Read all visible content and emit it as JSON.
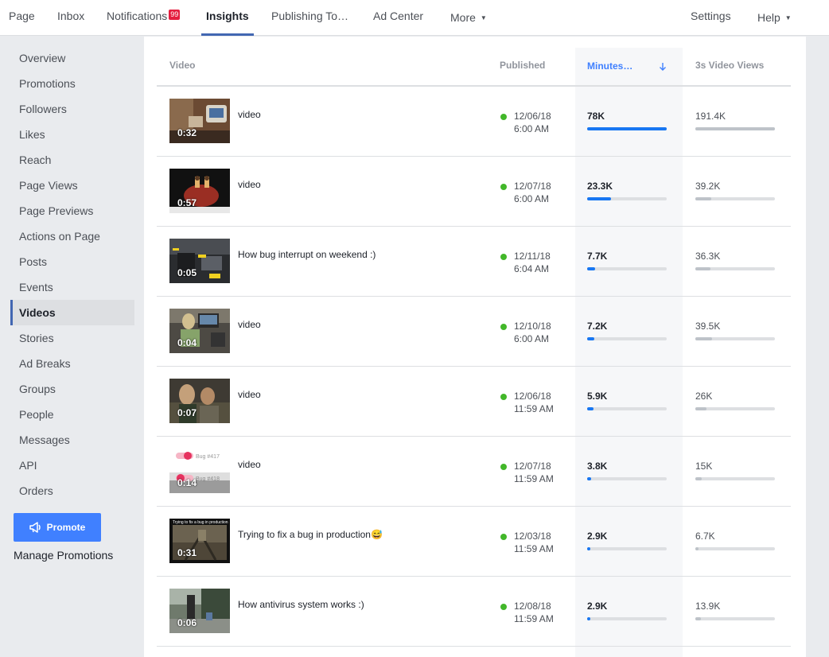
{
  "nav": {
    "tabs": [
      {
        "label": "Page"
      },
      {
        "label": "Inbox"
      },
      {
        "label": "Notifications",
        "badge": "99"
      },
      {
        "label": "Insights"
      },
      {
        "label": "Publishing To…"
      },
      {
        "label": "Ad Center"
      },
      {
        "label": "More"
      }
    ],
    "settings": "Settings",
    "help": "Help",
    "active": "Insights"
  },
  "sidebar": {
    "items": [
      "Overview",
      "Promotions",
      "Followers",
      "Likes",
      "Reach",
      "Page Views",
      "Page Previews",
      "Actions on Page",
      "Posts",
      "Events",
      "Videos",
      "Stories",
      "Ad Breaks",
      "Groups",
      "People",
      "Messages",
      "API",
      "Orders"
    ],
    "active": "Videos",
    "promote_label": "Promote",
    "manage_label": "Manage Promotions"
  },
  "table": {
    "headers": {
      "video": "Video",
      "published": "Published",
      "minutes": "Minutes…",
      "views": "3s Video Views"
    },
    "sort_icon": "arrow-down-icon",
    "rows": [
      {
        "duration": "0:32",
        "title": "video",
        "date": "12/06/18",
        "time": "6:00 AM",
        "minutes": "78K",
        "views": "191.4K",
        "minutes_frac": 1.0,
        "views_frac": 1.0
      },
      {
        "duration": "0:57",
        "title": "video",
        "date": "12/07/18",
        "time": "6:00 AM",
        "minutes": "23.3K",
        "views": "39.2K",
        "minutes_frac": 0.3,
        "views_frac": 0.2
      },
      {
        "duration": "0:05",
        "title": "How bug interrupt on weekend :)",
        "date": "12/11/18",
        "time": "6:04 AM",
        "minutes": "7.7K",
        "views": "36.3K",
        "minutes_frac": 0.1,
        "views_frac": 0.19
      },
      {
        "duration": "0:04",
        "title": "video",
        "date": "12/10/18",
        "time": "6:00 AM",
        "minutes": "7.2K",
        "views": "39.5K",
        "minutes_frac": 0.09,
        "views_frac": 0.21
      },
      {
        "duration": "0:07",
        "title": "video",
        "date": "12/06/18",
        "time": "11:59 AM",
        "minutes": "5.9K",
        "views": "26K",
        "minutes_frac": 0.08,
        "views_frac": 0.14
      },
      {
        "duration": "0:14",
        "title": "video",
        "date": "12/07/18",
        "time": "11:59 AM",
        "minutes": "3.8K",
        "views": "15K",
        "minutes_frac": 0.05,
        "views_frac": 0.08
      },
      {
        "duration": "0:31",
        "title": "Trying to fix a bug in production😅",
        "date": "12/03/18",
        "time": "11:59 AM",
        "minutes": "2.9K",
        "views": "6.7K",
        "minutes_frac": 0.04,
        "views_frac": 0.035
      },
      {
        "duration": "0:06",
        "title": "How antivirus system works :)",
        "date": "12/08/18",
        "time": "11:59 AM",
        "minutes": "2.9K",
        "views": "13.9K",
        "minutes_frac": 0.04,
        "views_frac": 0.07
      }
    ],
    "thumb_texts": {
      "bug1": "Bug #417",
      "bug2": "Bug #418",
      "prod": "Trying to fix a bug in production"
    }
  },
  "colors": {
    "accent": "#4267b2",
    "promote": "#4080ff",
    "bar_blue": "#1877f2",
    "bar_gray": "#bec3c9",
    "status_green": "#42b72a"
  }
}
